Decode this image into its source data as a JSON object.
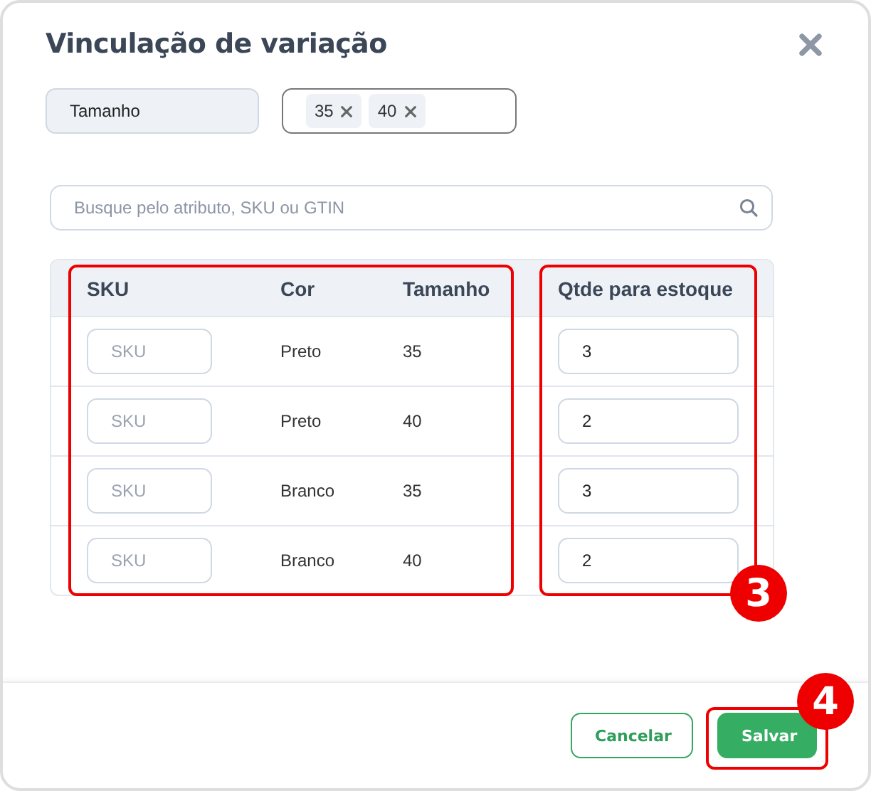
{
  "dialog": {
    "title": "Vinculação de variação"
  },
  "attribute": {
    "name": "Tamanho",
    "values": [
      "35",
      "40"
    ]
  },
  "search": {
    "placeholder": "Busque pelo atributo, SKU ou GTIN"
  },
  "table": {
    "columns": [
      "SKU",
      "Cor",
      "Tamanho",
      "Qtde para estoque"
    ],
    "rows": [
      {
        "sku_placeholder": "SKU",
        "cor": "Preto",
        "tamanho": "35",
        "qtde": "3"
      },
      {
        "sku_placeholder": "SKU",
        "cor": "Preto",
        "tamanho": "40",
        "qtde": "2"
      },
      {
        "sku_placeholder": "SKU",
        "cor": "Branco",
        "tamanho": "35",
        "qtde": "3"
      },
      {
        "sku_placeholder": "SKU",
        "cor": "Branco",
        "tamanho": "40",
        "qtde": "2"
      }
    ]
  },
  "buttons": [
    {
      "label": "Cancelar",
      "kind": "secondary"
    },
    {
      "label": "Salvar",
      "kind": "primary"
    }
  ],
  "annotations": [
    {
      "kind": "box"
    },
    {
      "kind": "box"
    },
    {
      "kind": "badge",
      "label": "3"
    },
    {
      "kind": "box"
    },
    {
      "kind": "badge",
      "label": "4"
    }
  ]
}
